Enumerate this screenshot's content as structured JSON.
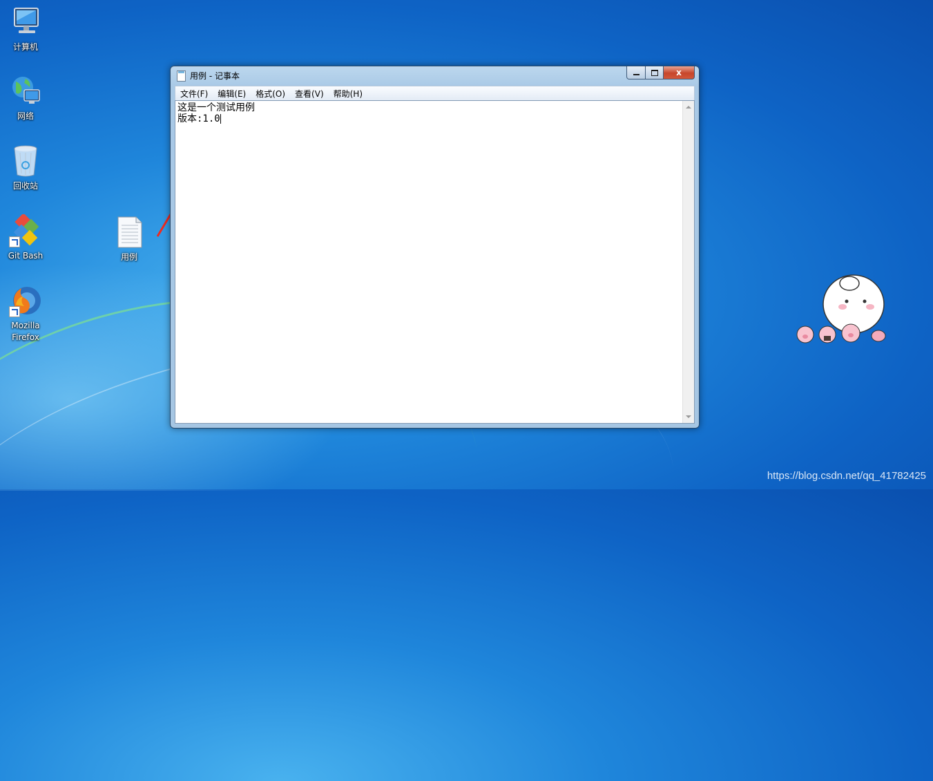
{
  "desktop": {
    "icons": [
      {
        "label": "计算机"
      },
      {
        "label": "网络"
      },
      {
        "label": "回收站"
      },
      {
        "label": "Git Bash"
      },
      {
        "label": "Mozilla Firefox"
      },
      {
        "label": "用例"
      }
    ]
  },
  "notepad": {
    "title": "用例 - 记事本",
    "menu": [
      "文件(F)",
      "编辑(E)",
      "格式(O)",
      "查看(V)",
      "帮助(H)"
    ],
    "lines": [
      "这是一个测试用例",
      "版本:1.0"
    ],
    "close_glyph": "x"
  },
  "watermark": "https://blog.csdn.net/qq_41782425",
  "colors": {
    "desktop_blue": "#1f86db",
    "annotation_arrow": "#f02a1e"
  }
}
